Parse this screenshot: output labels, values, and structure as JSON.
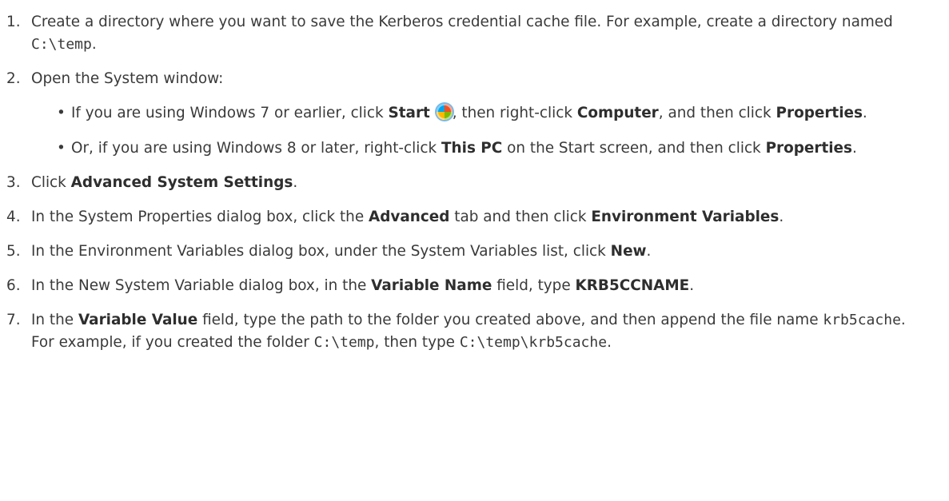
{
  "steps": [
    {
      "number": "1.",
      "text_a": "Create a directory where you want to save the Kerberos credential cache file. For example, create a directory named ",
      "code_a": "C:\\temp",
      "text_b": "."
    },
    {
      "number": "2.",
      "text": "Open the System window:",
      "bullets": [
        {
          "marker": "•",
          "t1": "If you are using Windows 7 or earlier, click ",
          "b1": "Start",
          "icon": "windows-start-orb-icon",
          "t2": ", then right-click ",
          "b2": "Computer",
          "t3": ", and then click ",
          "b3": "Properties",
          "t4": "."
        },
        {
          "marker": "•",
          "t1": "Or, if you are using Windows 8 or later, right-click ",
          "b1": "This PC",
          "t2": " on the Start screen, and then click ",
          "b2": "Properties",
          "t3": "."
        }
      ]
    },
    {
      "number": "3.",
      "t1": "Click ",
      "b1": "Advanced System Settings",
      "t2": "."
    },
    {
      "number": "4.",
      "t1": "In the System Properties dialog box, click the ",
      "b1": "Advanced",
      "t2": " tab and then click ",
      "b2": "Environment Variables",
      "t3": "."
    },
    {
      "number": "5.",
      "t1": "In the Environment Variables dialog box, under the System Variables list, click ",
      "b1": "New",
      "t2": "."
    },
    {
      "number": "6.",
      "t1": "In the New System Variable dialog box, in the ",
      "b1": "Variable Name",
      "t2": " field, type ",
      "b2": "KRB5CCNAME",
      "t3": "."
    },
    {
      "number": "7.",
      "t1": "In the ",
      "b1": "Variable Value",
      "t2": " field, type the path to the folder you created above, and then append the file name ",
      "c1": "krb5cache",
      "t3": ". For example, if you created the folder ",
      "c2": "C:\\temp",
      "t4": ", then type ",
      "c3": "C:\\temp\\krb5cache",
      "t5": "."
    }
  ]
}
